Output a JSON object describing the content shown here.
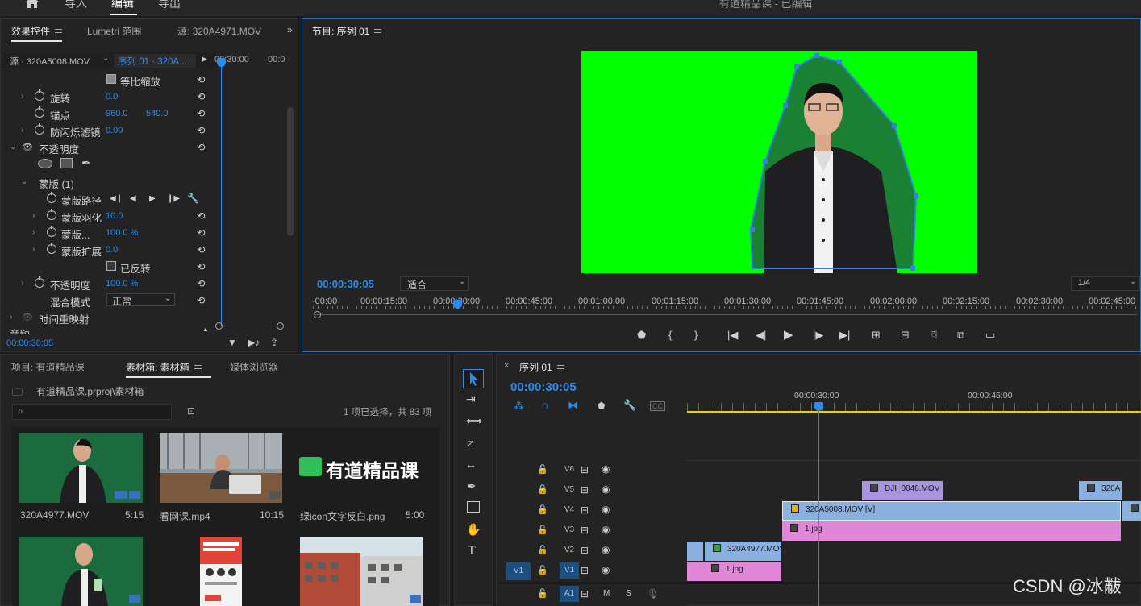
{
  "top_tabs": [
    "导入",
    "编辑",
    "导出"
  ],
  "window_title": "有道精品课 - 已编辑",
  "effect_controls": {
    "tabs": [
      "效果控件",
      "Lumetri 范围",
      "源: 320A4971.MOV"
    ],
    "source_label": "源 · 320A5008.MOV",
    "sequence_label": "序列 01 · 320A...",
    "ruler_times": [
      "00:30:00",
      "00:0"
    ],
    "rows": [
      {
        "label": "等比缩放"
      },
      {
        "label": "旋转",
        "v1": "0.0"
      },
      {
        "label": "锚点",
        "v1": "960.0",
        "v2": "540.0"
      },
      {
        "label": "防闪烁滤镜",
        "v1": "0.00"
      },
      {
        "label": "不透明度"
      },
      {
        "label": "蒙版 (1)"
      },
      {
        "label": "蒙版路径"
      },
      {
        "label": "蒙版羽化",
        "v1": "10.0"
      },
      {
        "label": "蒙版...",
        "v1": "100.0 %"
      },
      {
        "label": "蒙版扩展",
        "v1": "0.0"
      },
      {
        "label": "已反转"
      },
      {
        "label": "不透明度",
        "v1": "100.0 %"
      },
      {
        "label": "混合模式",
        "v1": "正常"
      },
      {
        "label": "时间重映射"
      },
      {
        "label": "音频"
      }
    ],
    "timecode": "00:00:30:05"
  },
  "program": {
    "tab": "节目: 序列 01",
    "timecode": "00:00:30:05",
    "fit": "适合",
    "resolution": "1/4",
    "ruler": [
      "-00:00",
      "00:00:15:00",
      "00:00:30:00",
      "00:00:45:00",
      "00:01:00:00",
      "00:01:15:00",
      "00:01:30:00",
      "00:01:45:00",
      "00:02:00:00",
      "00:02:15:00",
      "00:02:30:00",
      "00:02:45:00"
    ],
    "colors": {
      "chroma": "#00ff00"
    }
  },
  "project": {
    "tabs": [
      "项目: 有道精品课",
      "素材箱: 素材箱",
      "媒体浏览器"
    ],
    "path": "有道精品课.prproj\\素材箱",
    "selection": "1 项已选择，共 83 项",
    "items": [
      {
        "name": "320A4977.MOV",
        "duration": "5:15"
      },
      {
        "name": "看网课.mp4",
        "duration": "10:15"
      },
      {
        "name": "绿icon文字反白.png",
        "duration": "5:00"
      }
    ],
    "logo_text": "有道精品课"
  },
  "timeline": {
    "tab": "序列 01",
    "timecode": "00:00:30:05",
    "ruler": [
      "00:00:30:00",
      "00:00:45:00"
    ],
    "tracks": [
      "V6",
      "V5",
      "V4",
      "V3",
      "V2",
      "V1",
      "A1"
    ],
    "source_patch": "V1",
    "audio_buttons": [
      "M",
      "S"
    ],
    "clips": [
      {
        "name": "DJI_0048.MOV"
      },
      {
        "name": "320A"
      },
      {
        "name": "320A5008.MOV [V]"
      },
      {
        "name": "1.jpg"
      },
      {
        "name": "320A4977.MOV"
      },
      {
        "name": "1.jpg"
      }
    ]
  },
  "watermark": "CSDN @冰黻"
}
